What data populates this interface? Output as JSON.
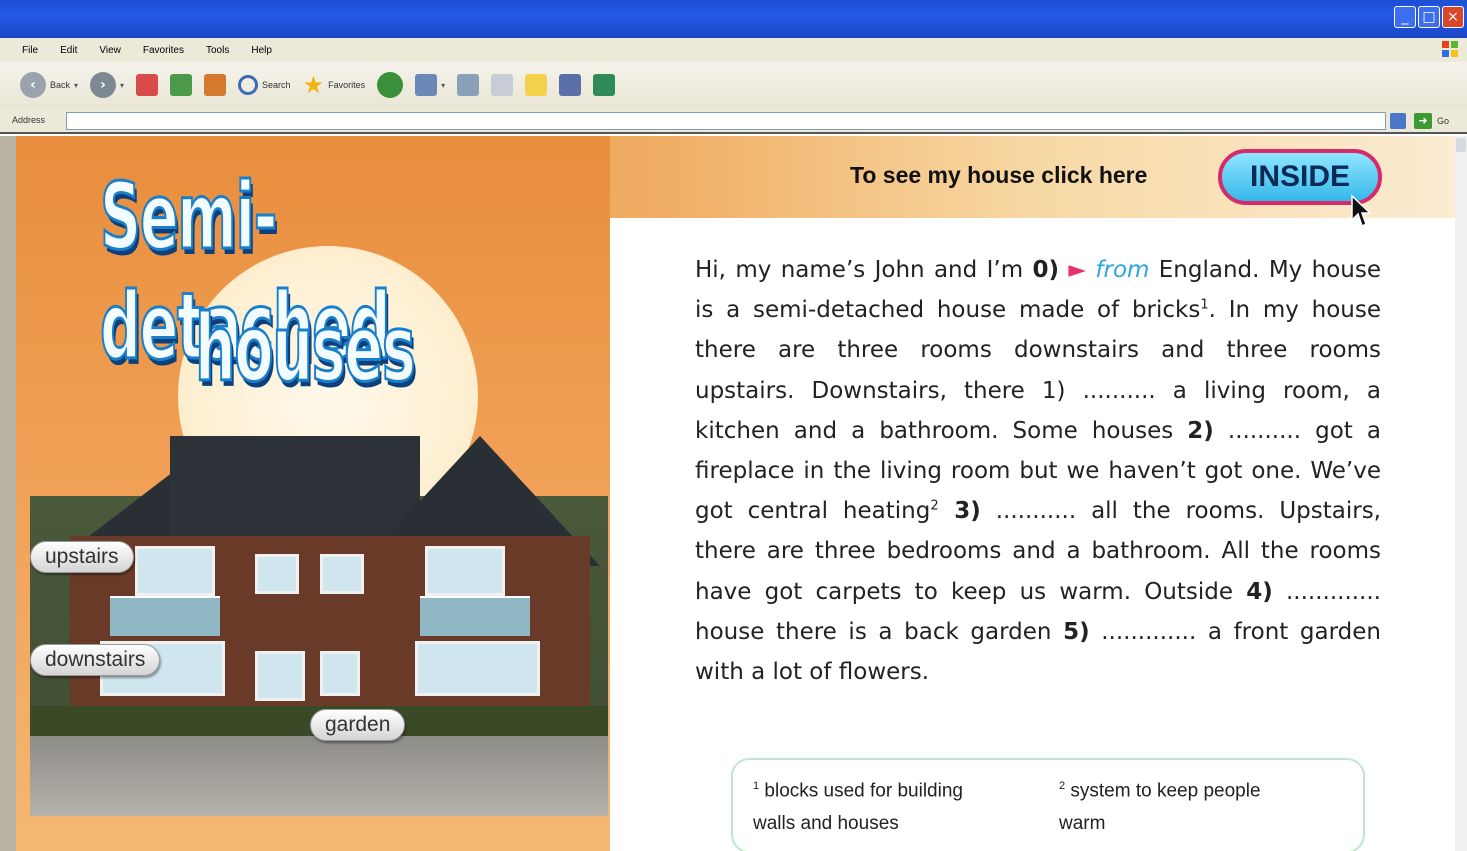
{
  "browser": {
    "menu": [
      "File",
      "Edit",
      "View",
      "Favorites",
      "Tools",
      "Help"
    ],
    "toolbar": {
      "back_label": "Back",
      "search_label": "Search",
      "favorites_label": "Favorites"
    },
    "address": {
      "label": "Address",
      "value": "",
      "go_label": "Go"
    }
  },
  "page": {
    "title_line1": "Semi-detached",
    "title_line2": "houses",
    "cta_text": "To see my house click here",
    "inside_button": "INSIDE",
    "tags": {
      "upstairs": "upstairs",
      "downstairs": "downstairs",
      "garden": "garden"
    },
    "paragraph": {
      "s0a": "Hi, my name’s John and I’m ",
      "n0": "0)",
      "arrow": "►",
      "ans0": "from",
      "s0b": " England. My house is a semi-detached house made of bricks",
      "sup1": "1",
      "s1": ". In my house there are three rooms downstairs and three rooms upstairs. Downstairs, there 1) .......... a living room, a kitchen and a bathroom. Some houses ",
      "n2": "2)",
      "s2": " .......... got a fireplace in the living room but we haven’t got one. We’ve got central heating",
      "sup2": "2",
      "n3": " 3)",
      "s3": " ........... all the rooms. Upstairs, there are three bedrooms and a bathroom. All the rooms have got carpets to keep us warm. Outside ",
      "n4": "4)",
      "s4": " ............. house there is a back garden ",
      "n5": "5)",
      "s5": " ............. a front garden with a lot of flowers."
    },
    "footnotes": {
      "fn1_num": "1",
      "fn1_line1": "blocks used for building",
      "fn1_line2": "walls and houses",
      "fn2_num": "2",
      "fn2_line1": "system to keep people",
      "fn2_line2": "warm"
    }
  },
  "colors": {
    "title_fill": "#f2fbff",
    "title_stroke": "#1a7fcb",
    "inside_border": "#d62b6a",
    "answer": "#2da5df",
    "arrow": "#e8306a"
  },
  "icons": [
    "back-icon",
    "forward-icon",
    "stop-icon",
    "refresh-icon",
    "home-icon",
    "search-icon",
    "favorites-star-icon",
    "history-icon",
    "mail-icon",
    "print-icon",
    "edit-icon",
    "discuss-icon",
    "messenger-icon",
    "windows-flag-icon",
    "go-arrow-icon"
  ]
}
